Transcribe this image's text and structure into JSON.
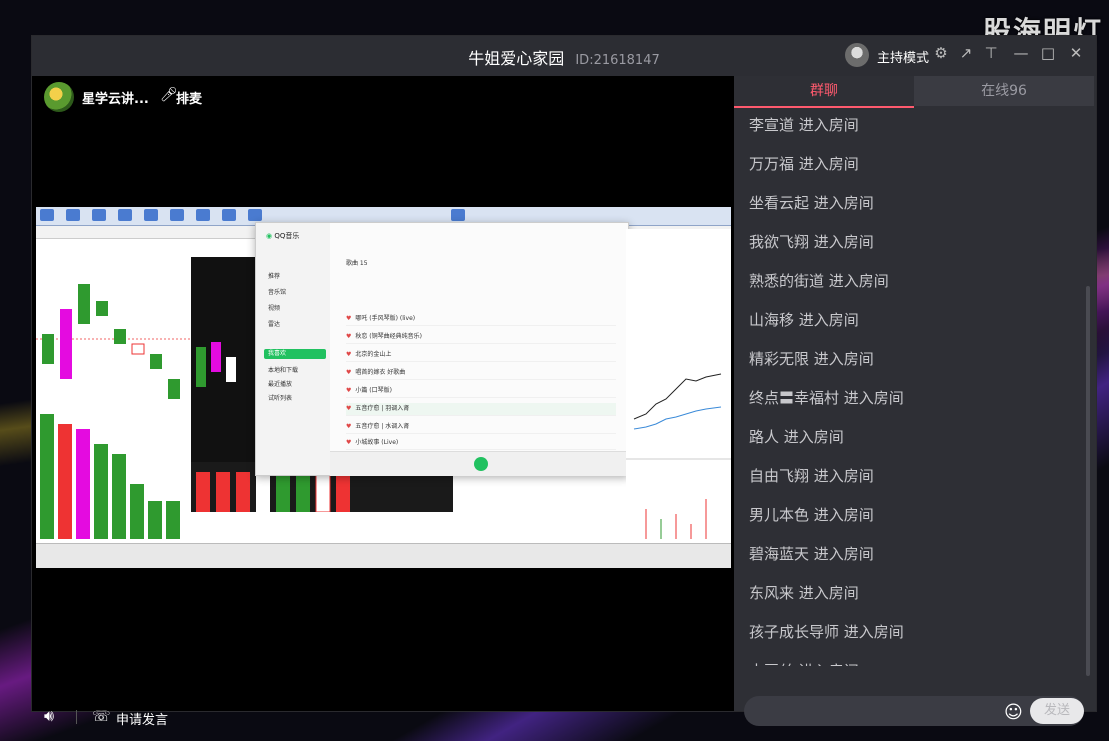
{
  "desktop": {
    "watermark": "股海明灯"
  },
  "window": {
    "title": "牛姐爱心家园",
    "room_id": "ID:21618147",
    "host_mode_label": "主持模式",
    "icons": [
      "settings-icon",
      "share-icon",
      "pin-icon",
      "minimize-icon",
      "maximize-icon",
      "close-icon"
    ]
  },
  "stage": {
    "streamer_name": "星学云讲...",
    "mic_label": "排麦"
  },
  "bottom": {
    "apply_label": "申请发言"
  },
  "chat_panel": {
    "tabs": [
      {
        "label": "群聊",
        "active": true
      },
      {
        "label": "在线96",
        "active": false
      }
    ],
    "messages": [
      "李宣道 进入房间",
      "万万福 进入房间",
      "坐看云起 进入房间",
      "我欲飞翔 进入房间",
      "熟悉的街道 进入房间",
      "山海移 进入房间",
      "精彩无限 进入房间",
      "终点〓幸福村 进入房间",
      "路人 进入房间",
      "自由飞翔 进入房间",
      "男儿本色 进入房间",
      "碧海蓝天 进入房间",
      "东风来 进入房间",
      "孩子成长导师 进入房间",
      "土豆丝 进入房间"
    ],
    "send_label": "发送"
  },
  "shared_screen": {
    "qq_music": {
      "app_name": "QQ音乐",
      "side_items": [
        "推荐",
        "音乐馆",
        "视频",
        "雷达",
        "我喜欢",
        "本地和下载",
        "最近播放",
        "试听列表"
      ],
      "tab": "歌曲 15",
      "rows": [
        "哪吒 (手风琴版) (live)",
        "秋恋 (铜琴曲经典纯音乐)",
        "北京的金山上",
        "唱首的嫁衣 好歌曲",
        "小篇 (口琴版)",
        "五音疗愈 | 羽调入肾",
        "五音疗愈 | 水调入肾",
        "小城故事 (Live)"
      ]
    }
  },
  "colors": {
    "title_bar": "#2c2d33",
    "panel_bg": "#2e2f35",
    "accent": "#ff5a6e",
    "qq_green": "#21c160"
  }
}
